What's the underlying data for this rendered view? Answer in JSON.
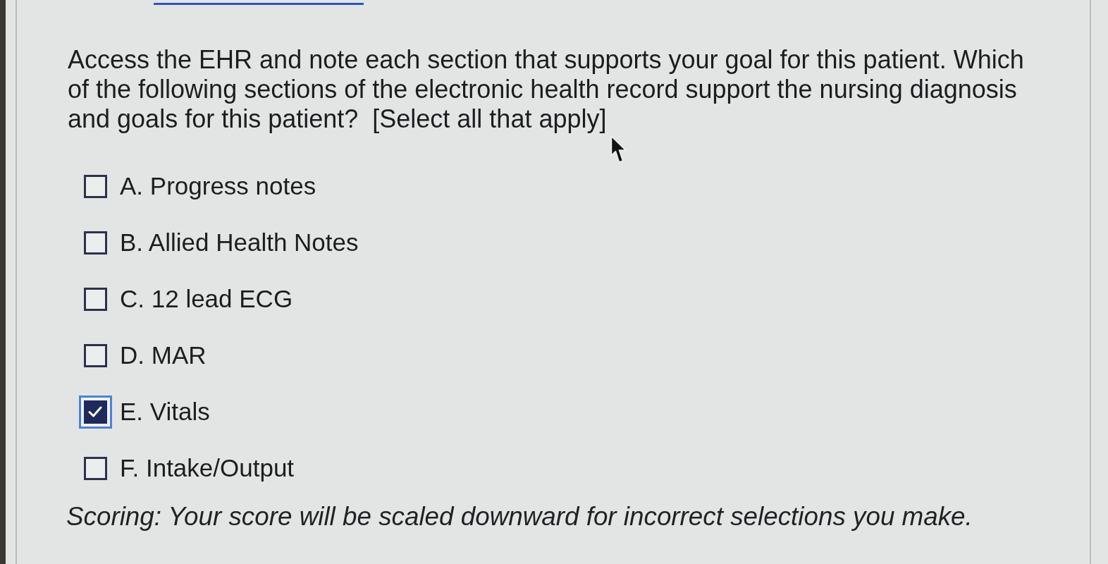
{
  "question": {
    "prompt": "Access the EHR and note each section that supports your goal for this patient. Which of the following sections of the electronic health record support the nursing diagnosis and goals for this patient?  [Select all that apply]"
  },
  "options": [
    {
      "label": "A. Progress notes",
      "checked": false,
      "focused": false
    },
    {
      "label": "B. Allied Health Notes",
      "checked": false,
      "focused": false
    },
    {
      "label": "C. 12 lead ECG",
      "checked": false,
      "focused": false
    },
    {
      "label": "D. MAR",
      "checked": false,
      "focused": false
    },
    {
      "label": "E. Vitals",
      "checked": true,
      "focused": true
    },
    {
      "label": "F. Intake/Output",
      "checked": false,
      "focused": false
    }
  ],
  "scoring_note": "Scoring: Your score will be scaled downward for incorrect selections you make."
}
